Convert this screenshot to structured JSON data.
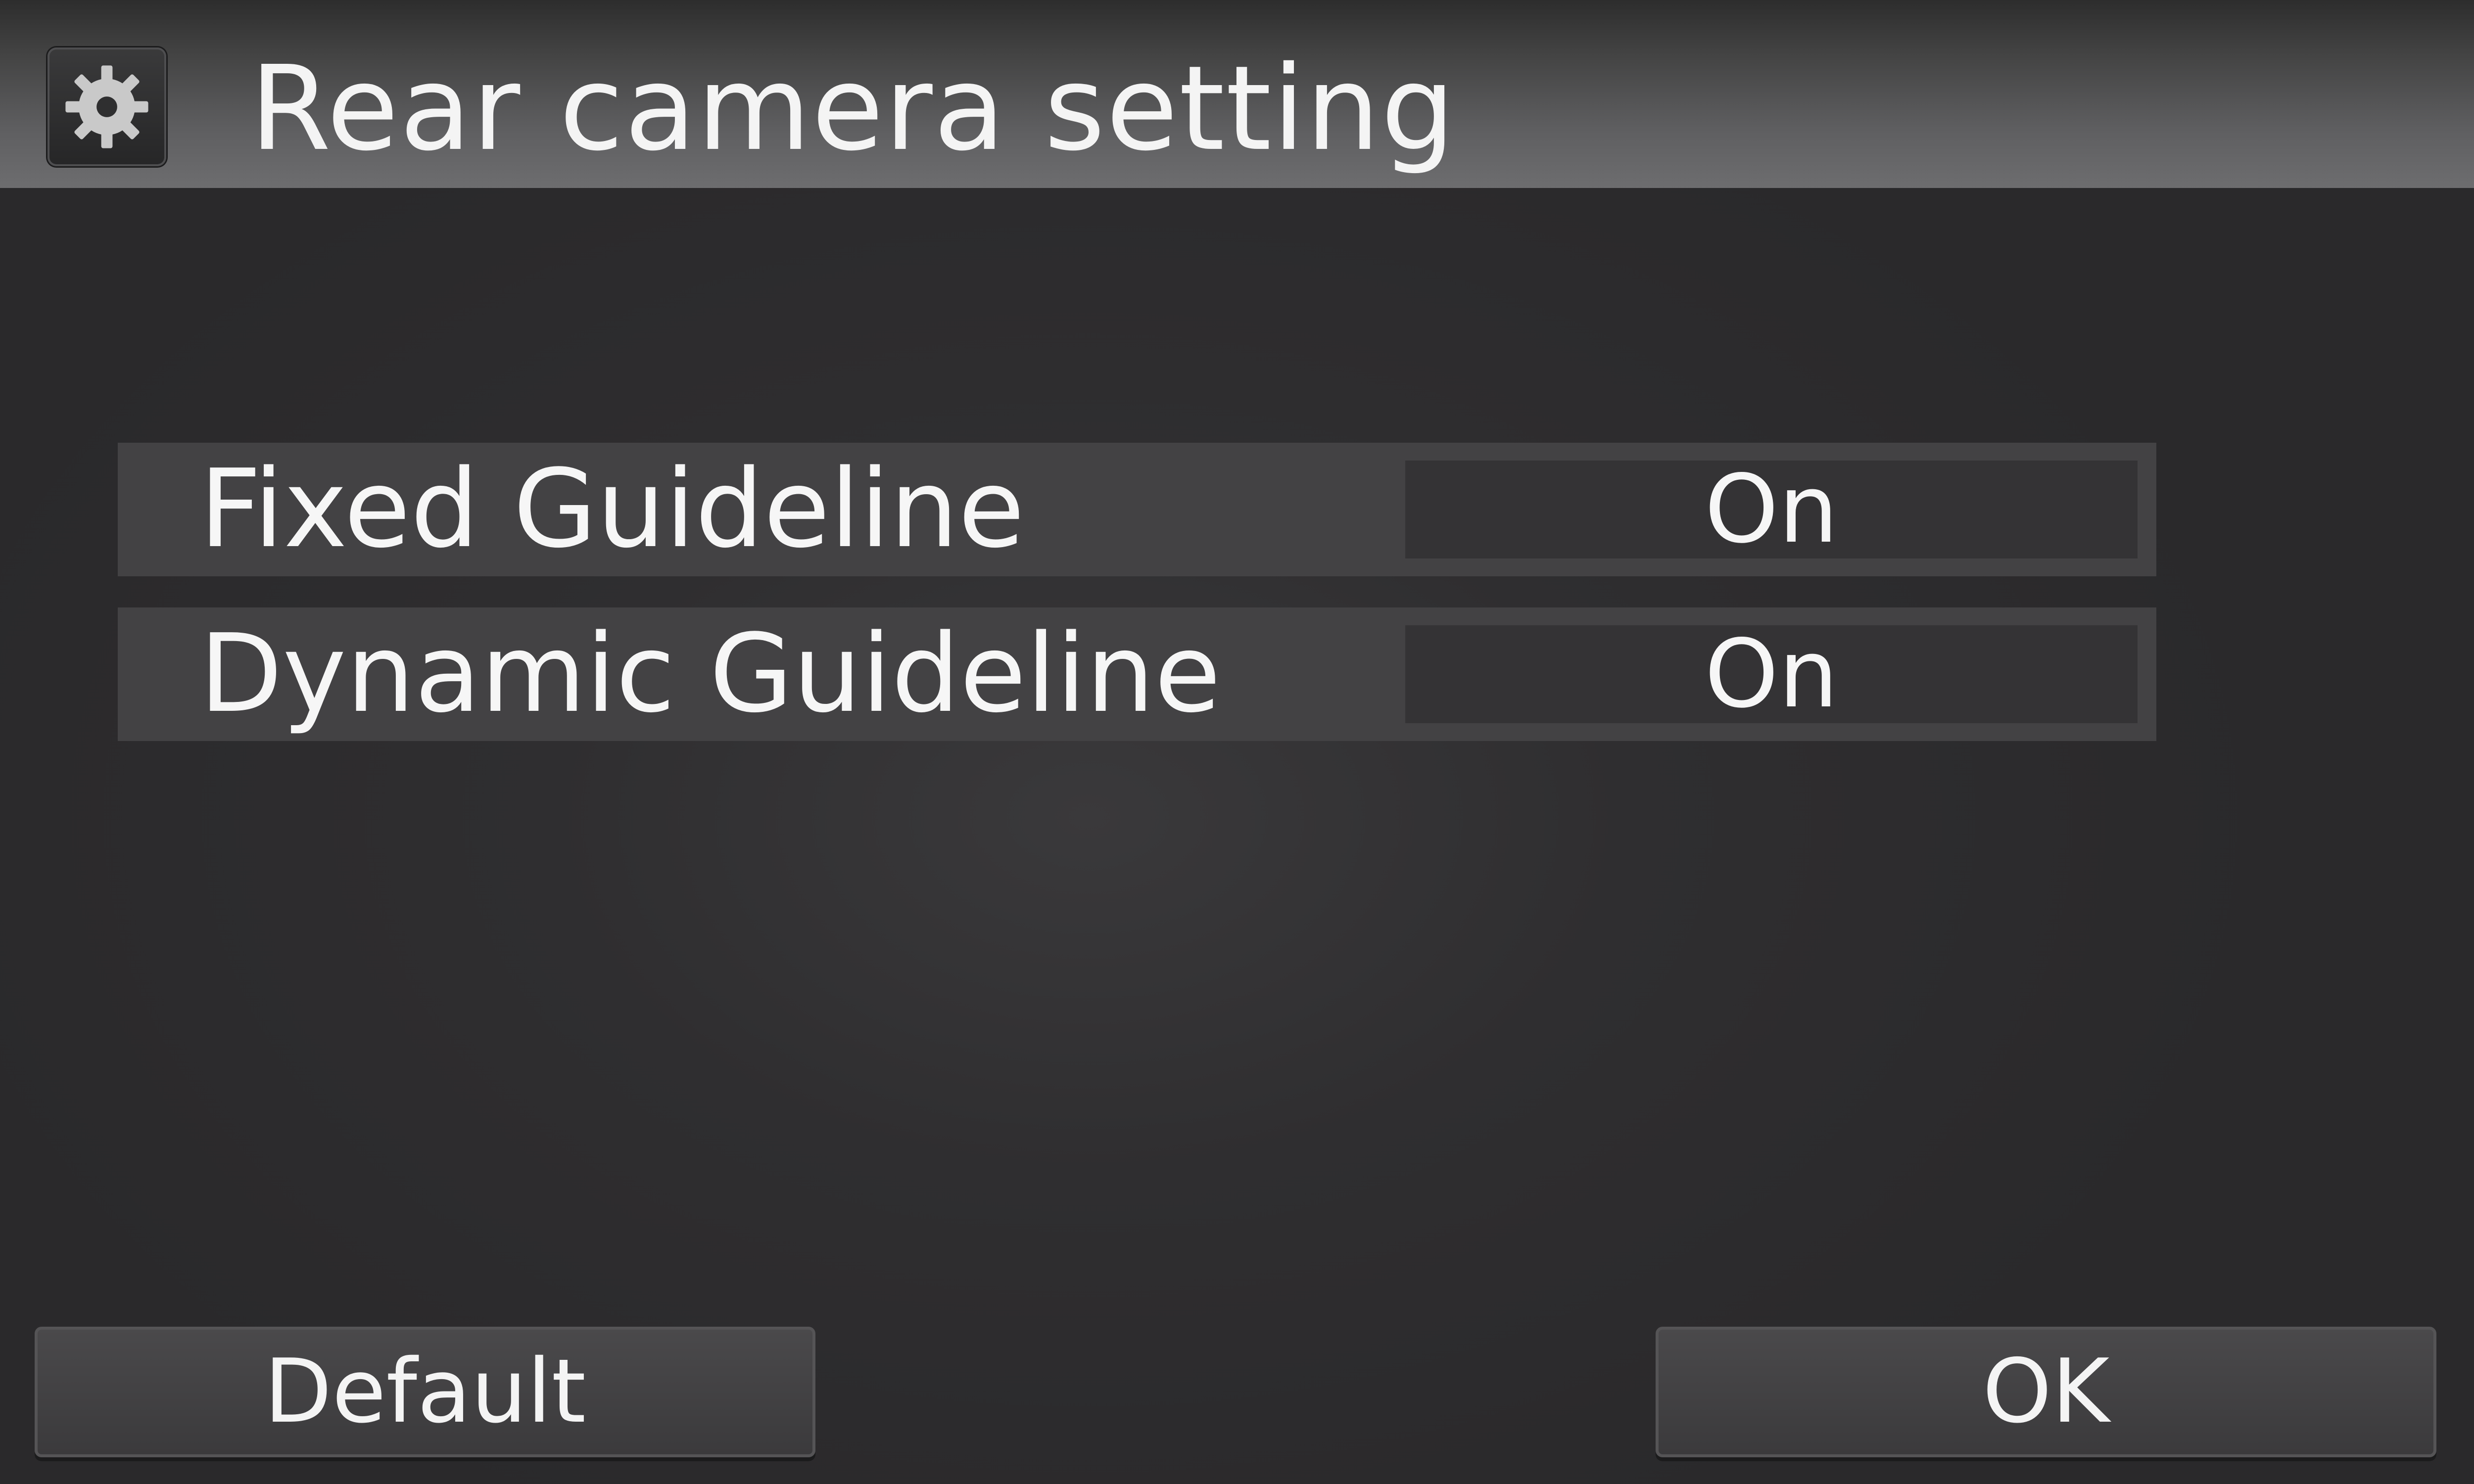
{
  "header": {
    "title": "Rear camera setting",
    "icon": "gear-icon"
  },
  "settings": [
    {
      "label": "Fixed Guideline",
      "value": "On"
    },
    {
      "label": "Dynamic Guideline",
      "value": "On"
    }
  ],
  "buttons": {
    "default_label": "Default",
    "ok_label": "OK"
  },
  "colors": {
    "background": "#2b2a2b",
    "row": "#434244",
    "value_box": "#343335",
    "text": "#f6f6f6"
  }
}
